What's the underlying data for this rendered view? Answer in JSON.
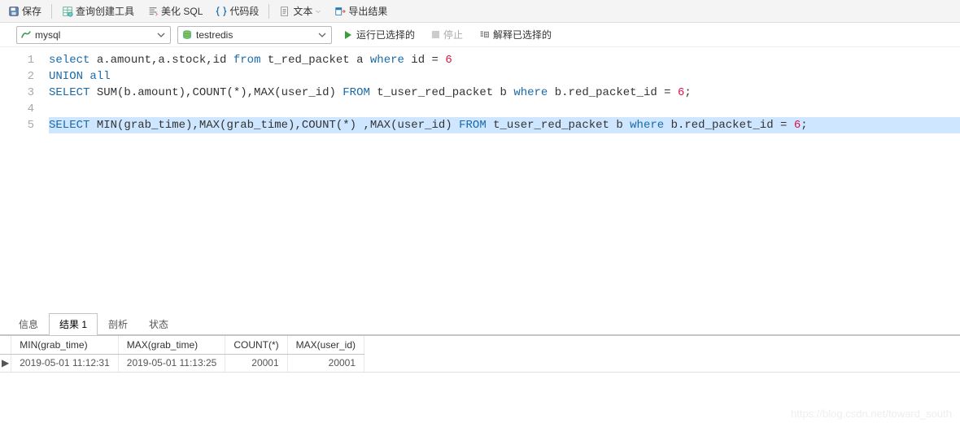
{
  "toolbar": {
    "save": "保存",
    "query_builder": "查询创建工具",
    "beautify": "美化 SQL",
    "snippet": "代码段",
    "text": "文本",
    "export": "导出结果"
  },
  "dropdowns": {
    "connection": "mysql",
    "database": "testredis"
  },
  "runbar": {
    "run": "运行已选择的",
    "stop": "停止",
    "explain": "解释已选择的"
  },
  "editor": {
    "lines": [
      {
        "n": "1",
        "parts": [
          {
            "t": "select",
            "c": "kw-select"
          },
          {
            "t": " a.amount,a.stock,id ",
            "c": ""
          },
          {
            "t": "from",
            "c": "kw-from"
          },
          {
            "t": " t_red_packet a ",
            "c": ""
          },
          {
            "t": "where",
            "c": "kw-where"
          },
          {
            "t": " id = ",
            "c": ""
          },
          {
            "t": "6",
            "c": "num"
          }
        ]
      },
      {
        "n": "2",
        "parts": [
          {
            "t": "UNION",
            "c": "kw-union"
          },
          {
            "t": " ",
            "c": ""
          },
          {
            "t": "all",
            "c": "kw-union"
          }
        ]
      },
      {
        "n": "3",
        "parts": [
          {
            "t": "SELECT",
            "c": "kw-select"
          },
          {
            "t": " SUM(b.amount),COUNT(*),MAX(user_id) ",
            "c": ""
          },
          {
            "t": "FROM",
            "c": "kw-from"
          },
          {
            "t": " t_user_red_packet b ",
            "c": ""
          },
          {
            "t": "where",
            "c": "kw-where"
          },
          {
            "t": " b.red_packet_id = ",
            "c": ""
          },
          {
            "t": "6",
            "c": "num"
          },
          {
            "t": ";",
            "c": ""
          }
        ]
      },
      {
        "n": "4",
        "parts": []
      },
      {
        "n": "5",
        "hl": true,
        "parts": [
          {
            "t": "SELECT",
            "c": "kw-select"
          },
          {
            "t": " MIN(grab_time),MAX(grab_time),COUNT(*) ,MAX(user_id) ",
            "c": ""
          },
          {
            "t": "FROM",
            "c": "kw-from"
          },
          {
            "t": " t_user_red_packet b ",
            "c": ""
          },
          {
            "t": "where",
            "c": "kw-where"
          },
          {
            "t": " b.red_packet_id = ",
            "c": ""
          },
          {
            "t": "6",
            "c": "num"
          },
          {
            "t": ";",
            "c": ""
          }
        ]
      }
    ]
  },
  "tabs": {
    "info": "信息",
    "result": "结果 1",
    "profile": "剖析",
    "status": "状态"
  },
  "result": {
    "headers": [
      "MIN(grab_time)",
      "MAX(grab_time)",
      "COUNT(*)",
      "MAX(user_id)"
    ],
    "rows": [
      [
        "2019-05-01 11:12:31",
        "2019-05-01 11:13:25",
        "20001",
        "20001"
      ]
    ]
  },
  "watermark": "https://blog.csdn.net/toward_south"
}
